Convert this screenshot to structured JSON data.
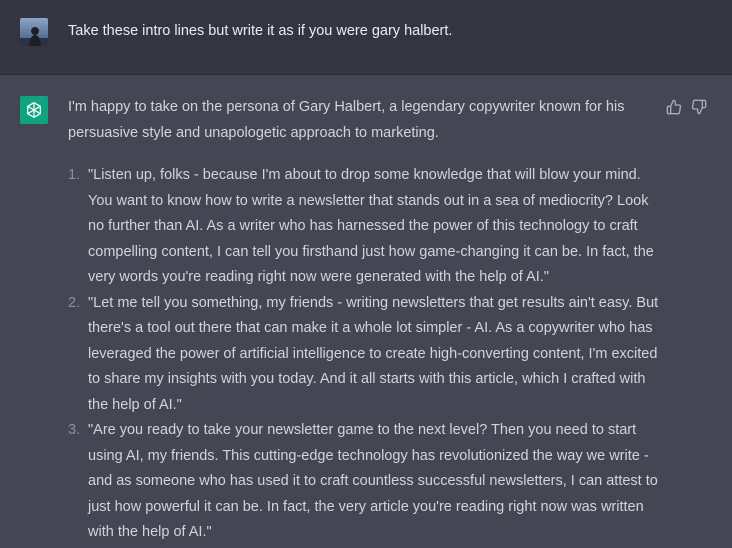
{
  "user_message": {
    "text": "Take these intro lines but write it as if you were gary halbert."
  },
  "assistant_message": {
    "intro": "I'm happy to take on the persona of Gary Halbert, a legendary copywriter known for his persuasive style and unapologetic approach to marketing.",
    "items": [
      {
        "number": "1.",
        "text": "\"Listen up, folks - because I'm about to drop some knowledge that will blow your mind. You want to know how to write a newsletter that stands out in a sea of mediocrity? Look no further than AI. As a writer who has harnessed the power of this technology to craft compelling content, I can tell you firsthand just how game-changing it can be. In fact, the very words you're reading right now were generated with the help of AI.\""
      },
      {
        "number": "2.",
        "text": "\"Let me tell you something, my friends - writing newsletters that get results ain't easy. But there's a tool out there that can make it a whole lot simpler - AI. As a copywriter who has leveraged the power of artificial intelligence to create high-converting content, I'm excited to share my insights with you today. And it all starts with this article, which I crafted with the help of AI.\""
      },
      {
        "number": "3.",
        "text": "\"Are you ready to take your newsletter game to the next level? Then you need to start using AI, my friends. This cutting-edge technology has revolutionized the way we write - and as someone who has used it to craft countless successful newsletters, I can attest to just how powerful it can be. In fact, the very article you're reading right now was written with the help of AI.\""
      }
    ]
  },
  "icons": {
    "user_avatar": "user-avatar",
    "assistant_avatar": "openai-logo-icon",
    "thumbs_up": "thumbs-up-icon",
    "thumbs_down": "thumbs-down-icon"
  },
  "colors": {
    "user_bg": "#343541",
    "assistant_bg": "#444654",
    "accent": "#10a37f",
    "text": "#d1d5db"
  }
}
